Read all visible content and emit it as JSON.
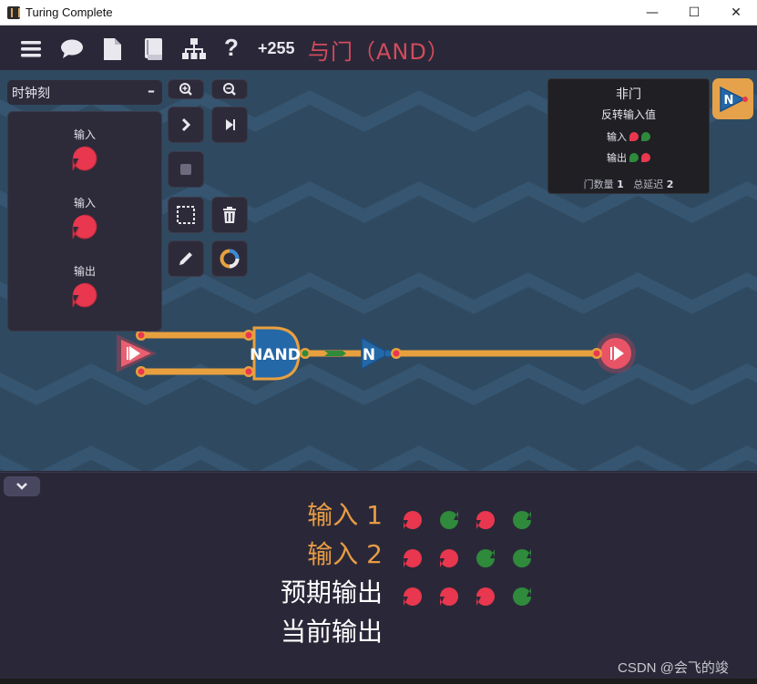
{
  "window": {
    "title": "Turing Complete",
    "minimize": "—",
    "maximize": "☐",
    "close": "✕"
  },
  "toolbar": {
    "icons": [
      "menu-icon",
      "chat-icon",
      "document-icon",
      "book-icon",
      "hierarchy-icon",
      "help-icon"
    ],
    "help_label": "?",
    "score": "+255",
    "level_title": "与门（AND）"
  },
  "left_panel": {
    "clock_label": "时钟刻",
    "clock_toggle": "–",
    "components": [
      {
        "label": "输入",
        "color": "#e8374e"
      },
      {
        "label": "输入",
        "color": "#e8374e"
      },
      {
        "label": "输出",
        "color": "#e8374e"
      }
    ]
  },
  "tools": [
    "zoom-in-icon",
    "zoom-out-icon",
    "step-icon",
    "play-icon",
    "stop-icon",
    "select-icon",
    "delete-icon",
    "pencil-icon",
    "color-ring-icon"
  ],
  "info_card": {
    "name": "非门",
    "description": "反转输入值",
    "input_label": "输入",
    "output_label": "输出",
    "gate_count_label": "门数量",
    "gate_count": "1",
    "delay_label": "总延迟",
    "delay": "2"
  },
  "circuit": {
    "nand_label": "NAND",
    "not_label": "N",
    "tile_label": "N",
    "colors": {
      "wire": "#e8a03e",
      "red": "#e8374e",
      "green": "#2f8a3c",
      "gate": "#2468a8",
      "canvas": "#2f4a60"
    }
  },
  "truth_table": {
    "rows": [
      {
        "label": "输入 1",
        "values": [
          "red",
          "green",
          "red",
          "green"
        ]
      },
      {
        "label": "输入 2",
        "values": [
          "red",
          "red",
          "green",
          "green"
        ]
      },
      {
        "label": "预期输出",
        "values": [
          "red",
          "red",
          "red",
          "green"
        ]
      },
      {
        "label": "当前输出",
        "values": []
      }
    ]
  },
  "watermark": "CSDN @会飞的竣"
}
